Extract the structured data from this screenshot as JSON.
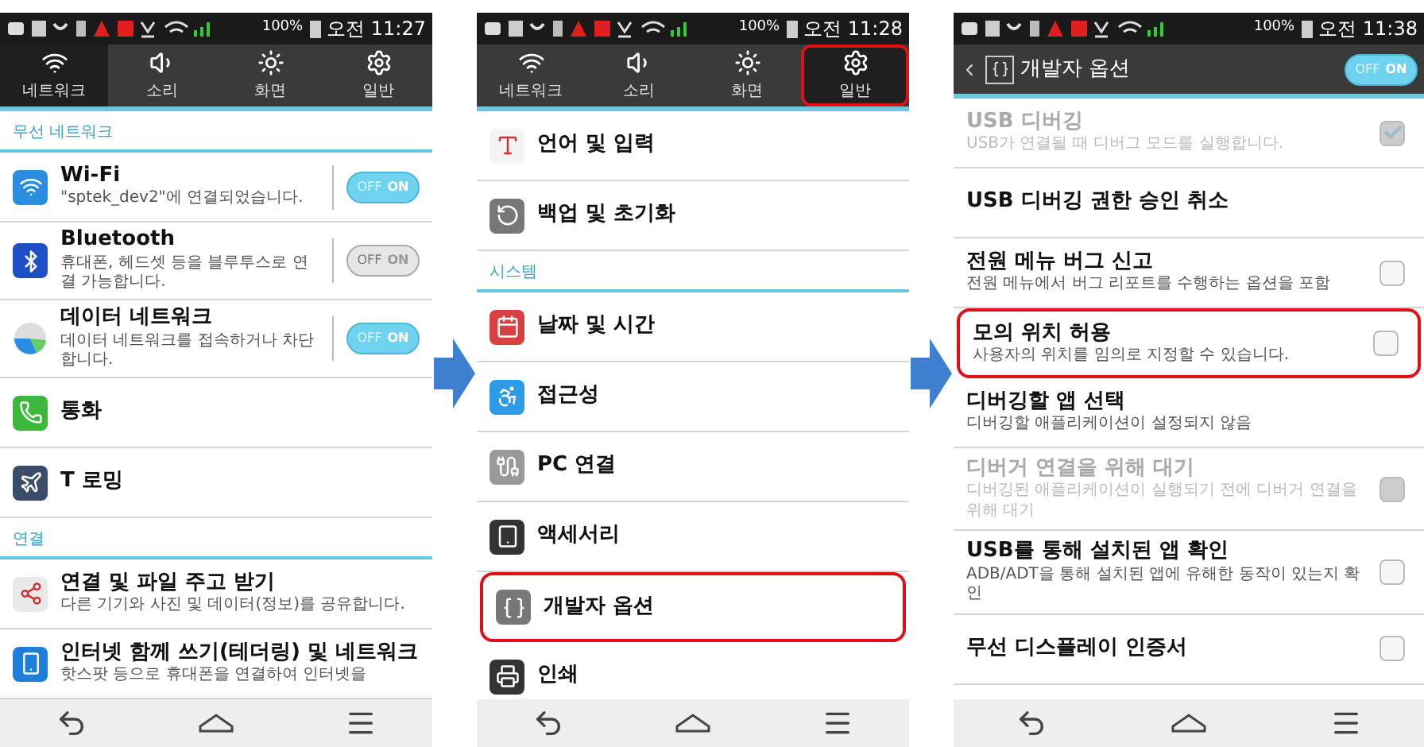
{
  "screens": [
    {
      "status_bar": {
        "battery": "100%",
        "time": "오전 11:27"
      },
      "tabs": [
        {
          "label": "네트워크",
          "selected": true
        },
        {
          "label": "소리",
          "selected": false
        },
        {
          "label": "화면",
          "selected": false
        },
        {
          "label": "일반",
          "selected": false
        }
      ],
      "items": [
        {
          "kind": "header",
          "title": "무선 네트워크"
        },
        {
          "kind": "toggle",
          "title": "Wi-Fi",
          "subtitle": "\"sptek_dev2\"에 연결되었습니다.",
          "on": true,
          "off_label": "OFF",
          "on_label": "ON"
        },
        {
          "kind": "toggle",
          "title": "Bluetooth",
          "subtitle": "휴대폰, 헤드셋 등을 블루투스로 연결 가능합니다.",
          "on": false,
          "off_label": "OFF",
          "on_label": "ON"
        },
        {
          "kind": "toggle",
          "title": "데이터 네트워크",
          "subtitle": "데이터 네트워크를 접속하거나 차단합니다.",
          "on": true,
          "off_label": "OFF",
          "on_label": "ON"
        },
        {
          "kind": "plain",
          "title": "통화"
        },
        {
          "kind": "plain",
          "title": "T 로밍"
        },
        {
          "kind": "header",
          "title": "연결"
        },
        {
          "kind": "plain",
          "title": "연결 및 파일 주고 받기",
          "subtitle": "다른 기기와 사진 및 데이터(정보)를 공유합니다."
        },
        {
          "kind": "plain",
          "title": "인터넷 함께 쓰기(테더링) 및 네트워크",
          "subtitle": "핫스팟 등으로 휴대폰을 연결하여 인터넷을"
        }
      ]
    },
    {
      "status_bar": {
        "battery": "100%",
        "time": "오전 11:28"
      },
      "tabs": [
        {
          "label": "네트워크",
          "selected": false,
          "highlighted": false
        },
        {
          "label": "소리",
          "selected": false,
          "highlighted": false
        },
        {
          "label": "화면",
          "selected": false,
          "highlighted": false
        },
        {
          "label": "일반",
          "selected": true,
          "highlighted": true
        }
      ],
      "items": [
        {
          "kind": "plain",
          "title": "언어 및 입력",
          "highlighted": false
        },
        {
          "kind": "plain",
          "title": "백업 및 초기화",
          "highlighted": false
        },
        {
          "kind": "header",
          "title": "시스템"
        },
        {
          "kind": "plain",
          "title": "날짜 및 시간",
          "highlighted": false
        },
        {
          "kind": "plain",
          "title": "접근성",
          "highlighted": false
        },
        {
          "kind": "plain",
          "title": "PC 연결",
          "highlighted": false
        },
        {
          "kind": "plain",
          "title": "액세서리",
          "highlighted": false
        },
        {
          "kind": "plain",
          "title": "개발자 옵션",
          "highlighted": true
        },
        {
          "kind": "plain",
          "title": "인쇄",
          "highlighted": false
        }
      ]
    },
    {
      "status_bar": {
        "battery": "100%",
        "time": "오전 11:38"
      },
      "title_bar": {
        "title": "개발자 옵션",
        "on": true,
        "off_label": "OFF",
        "on_label": "ON"
      },
      "items": [
        {
          "kind": "checkbox",
          "title": "USB 디버깅",
          "subtitle": "USB가 연결될 때 디버그 모드를 실행합니다.",
          "checked": true,
          "disabled": true,
          "highlighted": false
        },
        {
          "kind": "text",
          "title": "USB 디버깅 권한 승인 취소",
          "disabled": false,
          "highlighted": false
        },
        {
          "kind": "checkbox",
          "title": "전원 메뉴 버그 신고",
          "subtitle": "전원 메뉴에서 버그 리포트를 수행하는 옵션을 포함",
          "checked": false,
          "disabled": false,
          "highlighted": false
        },
        {
          "kind": "checkbox",
          "title": "모의 위치 허용",
          "subtitle": "사용자의 위치를 임의로 지정할 수 있습니다.",
          "checked": false,
          "disabled": false,
          "highlighted": true
        },
        {
          "kind": "text",
          "title": "디버깅할 앱 선택",
          "subtitle": "디버깅할 애플리케이션이 설정되지 않음",
          "disabled": false,
          "highlighted": false
        },
        {
          "kind": "checkbox",
          "title": "디버거 연결을 위해 대기",
          "subtitle": "디버깅된 애플리케이션이 실행되기 전에 디버거 연결을 위해 대기",
          "checked": false,
          "disabled": true,
          "highlighted": false
        },
        {
          "kind": "checkbox",
          "title": "USB를 통해 설치된 앱 확인",
          "subtitle": "ADB/ADT을 통해 설치된 앱에 유해한 동작이 있는지 확인",
          "checked": false,
          "disabled": false,
          "highlighted": false
        },
        {
          "kind": "checkbox",
          "title": "무선 디스플레이 인증서",
          "checked": false,
          "disabled": false,
          "highlighted": false
        }
      ]
    }
  ]
}
